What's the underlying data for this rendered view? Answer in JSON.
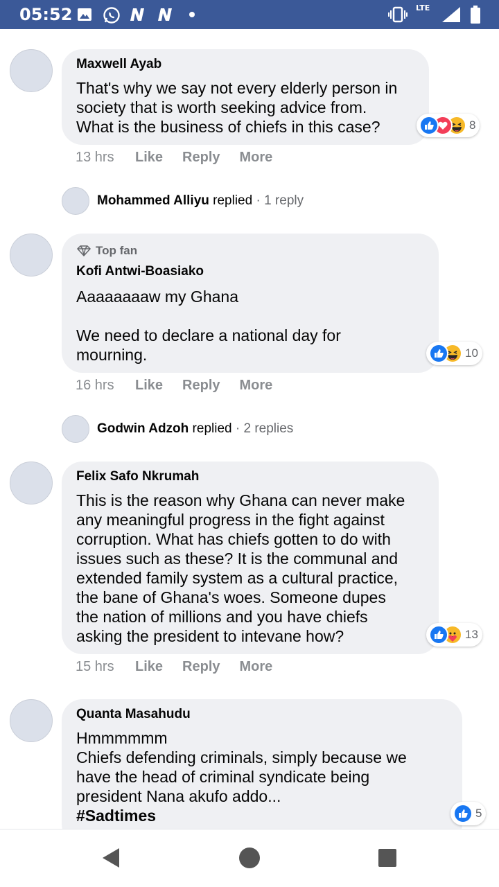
{
  "status_bar": {
    "time": "05:52",
    "network": "LTE",
    "icons": [
      "image-icon",
      "whatsapp-icon",
      "n-notification-icon",
      "n-notification-icon",
      "dot-icon",
      "vibrate-icon",
      "signal-icon",
      "battery-icon"
    ]
  },
  "comments": [
    {
      "author": "Maxwell Ayab",
      "text": "That's why we say not every elderly person in\nsociety that is worth seeking advice from.\nWhat is the business of chiefs in this case?",
      "reactions": [
        "like",
        "love",
        "haha"
      ],
      "reaction_count": "8",
      "time": "13 hrs",
      "like_label": "Like",
      "reply_label": "Reply",
      "more_label": "More",
      "replies": {
        "name": "Mohammed Alliyu",
        "verb": " replied",
        "meta": " · 1 reply"
      }
    },
    {
      "badge": "Top fan",
      "author": "Kofi Antwi-Boasiako",
      "text": "Aaaaaaaaw my Ghana\n\nWe need to declare a national day for\nmourning.",
      "reactions": [
        "like",
        "haha"
      ],
      "reaction_count": "10",
      "time": "16 hrs",
      "like_label": "Like",
      "reply_label": "Reply",
      "more_label": "More",
      "replies": {
        "name": "Godwin Adzoh",
        "verb": " replied",
        "meta": " · 2 replies"
      }
    },
    {
      "author": "Felix Safo Nkrumah",
      "text": "This is the reason why Ghana can never make\nany meaningful progress in the fight against\ncorruption. What has chiefs gotten to do with\nissues such as these? It is the communal and\nextended family system as a cultural practice,\nthe bane of Ghana's woes. Someone dupes\nthe nation of millions and you have chiefs\nasking the president to intevane how?",
      "reactions": [
        "like",
        "care"
      ],
      "reaction_count": "13",
      "time": "15 hrs",
      "like_label": "Like",
      "reply_label": "Reply",
      "more_label": "More"
    },
    {
      "author": "Quanta Masahudu",
      "text": "Hmmmmmm\nChiefs defending criminals, simply because we\nhave the head of criminal syndicate being\npresident Nana akufo addo...",
      "hashtag": "#Sadtimes",
      "reactions": [
        "like"
      ],
      "reaction_count": "5"
    }
  ],
  "nav": {
    "back": "back-icon",
    "home": "home-icon",
    "recents": "recents-icon"
  }
}
